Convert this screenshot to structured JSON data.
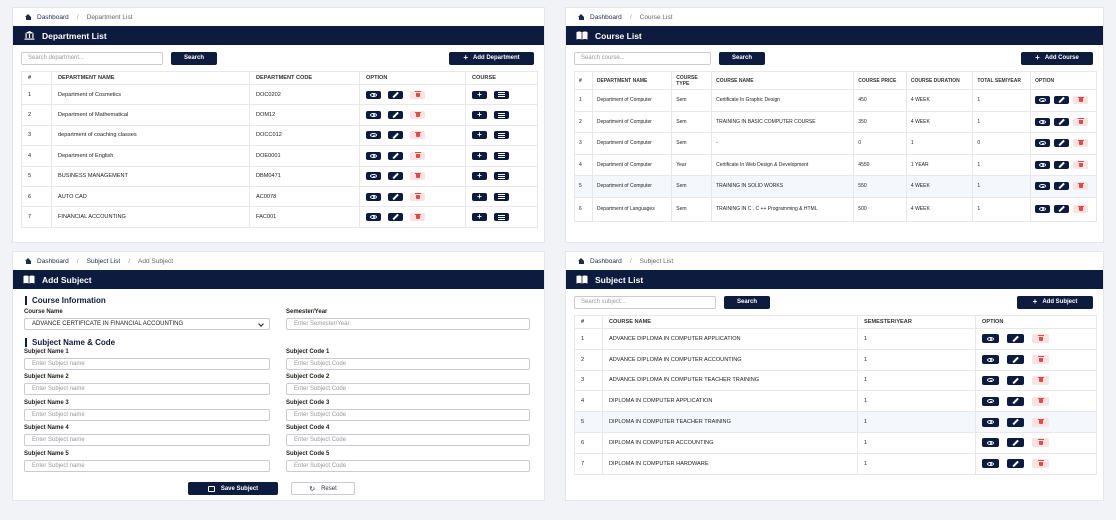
{
  "icons": {
    "home": "home-icon",
    "building": "building-icon",
    "book": "book-icon",
    "eye": "eye-icon",
    "pencil": "pencil-icon",
    "trash": "trash-icon",
    "plus": "plus-icon",
    "list": "list-icon",
    "save": "save-icon",
    "reset": "refresh-icon",
    "chevron": "chevron-down-icon"
  },
  "colors": {
    "navy": "#0d1b3e",
    "danger_bg": "#fde2e2",
    "danger": "#e04a4a"
  },
  "dept": {
    "breadcrumb": {
      "home": "Dashboard",
      "current": "Department List"
    },
    "title": "Department List",
    "search_placeholder": "Search department...",
    "search_label": "Search",
    "add_label": "Add Department",
    "columns": [
      "#",
      "DEPARTMENT NAME",
      "DEPARTMENT CODE",
      "OPTION",
      "COURSE"
    ],
    "rows": [
      {
        "n": "1",
        "name": "Department of Cosmetics",
        "code": "DOC0202"
      },
      {
        "n": "2",
        "name": "Department of Mathematical",
        "code": "DOM12"
      },
      {
        "n": "3",
        "name": "department of coaching classes",
        "code": "DOCC012"
      },
      {
        "n": "4",
        "name": "Department of English",
        "code": "DOE0001"
      },
      {
        "n": "5",
        "name": "BUSINESS MANAGEMENT",
        "code": "DBM0471"
      },
      {
        "n": "6",
        "name": "AUTO CAD",
        "code": "AC0078"
      },
      {
        "n": "7",
        "name": "FINANCIAL ACCOUNTING",
        "code": "FAC001"
      }
    ]
  },
  "course": {
    "breadcrumb": {
      "home": "Dashboard",
      "current": "Course List"
    },
    "title": "Course List",
    "search_placeholder": "Search course...",
    "search_label": "Search",
    "add_label": "Add Course",
    "columns": [
      "#",
      "DEPARTMENT NAME",
      "COURSE TYPE",
      "COURSE NAME",
      "COURSE PRICE",
      "COURSE DURATION",
      "TOTAL SEM/YEAR",
      "OPTION"
    ],
    "rows": [
      {
        "n": "1",
        "dept": "Department of Computer",
        "type": "Sem",
        "name": "Certificate In Graphic Design",
        "price": "450",
        "duration": "4 WEEK",
        "total": "1"
      },
      {
        "n": "2",
        "dept": "Department of Computer",
        "type": "Sem",
        "name": "TRAINING IN BASIC COMPUTER COURSE",
        "price": "350",
        "duration": "4 WEEK",
        "total": "1"
      },
      {
        "n": "3",
        "dept": "Department of Computer",
        "type": "Sem",
        "name": "-",
        "price": "0",
        "duration": "1",
        "total": "0"
      },
      {
        "n": "4",
        "dept": "Department of Computer",
        "type": "Year",
        "name": "Certificate In Web Design & Development",
        "price": "4550",
        "duration": "1 YEAR",
        "total": "1"
      },
      {
        "n": "5",
        "dept": "Department of Computer",
        "type": "Sem",
        "name": "TRAINING IN SOLID WORKS",
        "price": "550",
        "duration": "4 WEEK",
        "total": "1"
      },
      {
        "n": "6",
        "dept": "Department of Languages",
        "type": "Sem",
        "name": "TRAINING IN C , C ++ Programming & HTML",
        "price": "500",
        "duration": "4 WEEK",
        "total": "1"
      }
    ]
  },
  "add_subject": {
    "breadcrumb": {
      "home": "Dashboard",
      "mid": "Subject List",
      "current": "Add Subject"
    },
    "title": "Add Subject",
    "course_info": "Course Information",
    "course_label": "Course Name",
    "course_value": "ADVANCE CERTIFICATE IN FINANCIAL ACCOUNTING",
    "sem_label": "Semester/Year",
    "sem_placeholder": "Enter Semester/Year",
    "subject_section": "Subject Name & Code",
    "subjects": [
      {
        "name_label": "Subject Name 1",
        "name_ph": "Enter Subject name",
        "code_label": "Subject Code 1",
        "code_ph": "Enter Subject Code"
      },
      {
        "name_label": "Subject Name 2",
        "name_ph": "Enter Subject name",
        "code_label": "Subject Code 2",
        "code_ph": "Enter Subject Code"
      },
      {
        "name_label": "Subject Name 3",
        "name_ph": "Enter Subject name",
        "code_label": "Subject Code 3",
        "code_ph": "Enter Subject Code"
      },
      {
        "name_label": "Subject Name 4",
        "name_ph": "Enter Subject name",
        "code_label": "Subject Code 4",
        "code_ph": "Enter Subject Code"
      },
      {
        "name_label": "Subject Name 5",
        "name_ph": "Enter Subject name",
        "code_label": "Subject Code 5",
        "code_ph": "Enter Subject Code"
      }
    ],
    "save_label": "Save Subject",
    "reset_label": "Reset"
  },
  "subject": {
    "breadcrumb": {
      "home": "Dashboard",
      "current": "Subject List"
    },
    "title": "Subject List",
    "search_placeholder": "Search subject...",
    "search_label": "Search",
    "add_label": "Add Subject",
    "columns": [
      "#",
      "COURSE NAME",
      "SEMESTER/YEAR",
      "OPTION"
    ],
    "rows": [
      {
        "n": "1",
        "name": "ADVANCE DIPLOMA IN COMPUTER APPLICATION",
        "sem": "1"
      },
      {
        "n": "2",
        "name": "ADVANCE DIPLOMA IN COMPUTER ACCOUNTING",
        "sem": "1"
      },
      {
        "n": "3",
        "name": "ADVANCE DIPLOMA IN COMPUTER TEACHER TRAINING",
        "sem": "1"
      },
      {
        "n": "4",
        "name": "DIPLOMA IN COMPUTER APPLICATION",
        "sem": "1"
      },
      {
        "n": "5",
        "name": "DIPLOMA IN COMPUTER TEACHER TRAINING",
        "sem": "1"
      },
      {
        "n": "6",
        "name": "DIPLOMA IN COMPUTER ACCOUNTING",
        "sem": "1"
      },
      {
        "n": "7",
        "name": "DIPLOMA IN COMPUTER HARDWARE",
        "sem": "1"
      }
    ]
  }
}
